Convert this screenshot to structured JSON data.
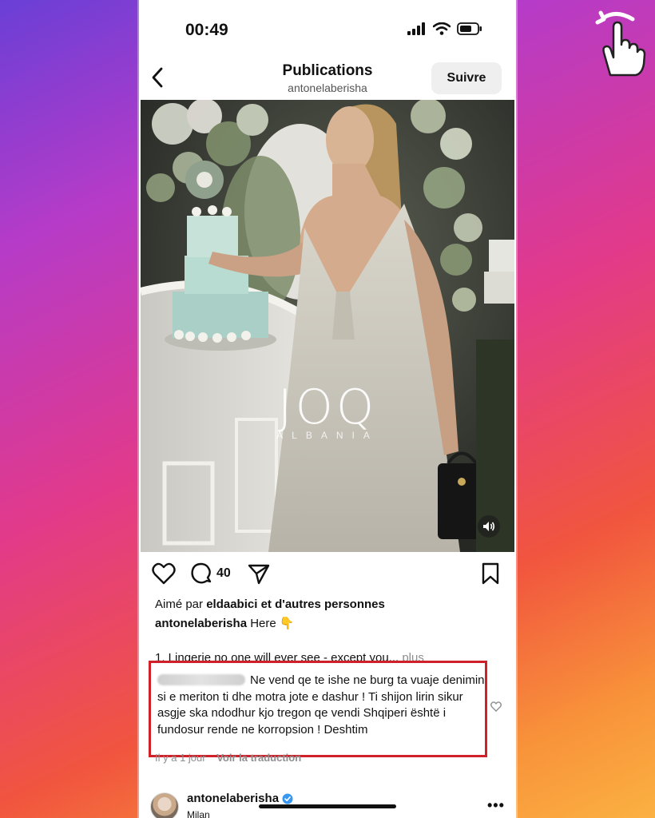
{
  "status_bar": {
    "time": "00:49"
  },
  "header": {
    "title": "Publications",
    "username": "antonelaberisha",
    "follow_label": "Suivre"
  },
  "media": {
    "watermark_brand": "JOQ",
    "watermark_sub": "ALBANIA"
  },
  "actions": {
    "comment_count": "40"
  },
  "likes": {
    "prefix": "Aimé par",
    "user": "eldaabici",
    "suffix": "et d'autres personnes"
  },
  "caption": {
    "user": "antonelaberisha",
    "text": "Here 👇",
    "body": "1. Lingerie no one will ever see - except you...",
    "more": "plus"
  },
  "highlighted_comment": {
    "text": "Ne vend qe te ishe ne burg ta vuaje denimin si e meriton ti dhe motra jote e dashur ! Ti shijon lirin sikur asgje ska ndodhur kjo tregon qe vendi Shqiperi është i fundosur rende ne korropsion ! Deshtim",
    "time": "Il y a 1 jour",
    "translate_label": "Voir la traduction",
    "highlight_color": "#d0212b"
  },
  "footer": {
    "username": "antonelaberisha",
    "location": "Milan"
  },
  "icons": {
    "swipe": "swipe-hand-icon",
    "back": "chevron-left-icon",
    "like": "heart-icon",
    "comment": "comment-bubble-icon",
    "share": "paper-plane-icon",
    "save": "bookmark-icon",
    "sound": "speaker-icon",
    "verified": "verified-badge-icon"
  }
}
